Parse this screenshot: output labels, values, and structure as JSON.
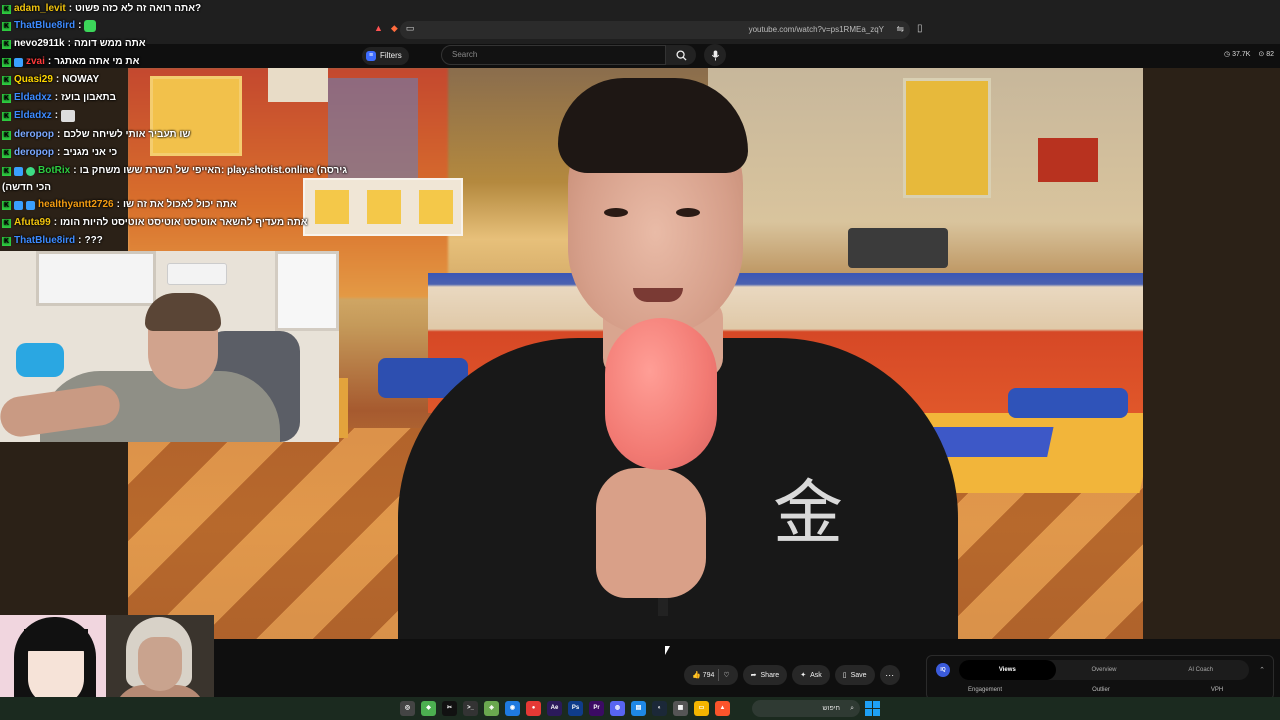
{
  "browser": {
    "url": "youtube.com/watch?v=ps1RMEa_zqY"
  },
  "youtube": {
    "filters_label": "Filters",
    "search_placeholder": "Search",
    "stats": {
      "views_stat": "37.7K",
      "score_stat": "82"
    }
  },
  "chat": {
    "messages": [
      {
        "user": "adam_levit",
        "user_color": "#f1c40f",
        "badges": [
          "k"
        ],
        "text": "אתה רואה זה לא כזה פשוט?"
      },
      {
        "user": "ThatBlue8ird",
        "user_color": "#3d8bff",
        "badges": [
          "k"
        ],
        "text": "",
        "emote": "green"
      },
      {
        "user": "nevo2911k",
        "user_color": "#ffffff",
        "badges": [
          "k"
        ],
        "text": "אתה ממש דומה"
      },
      {
        "user": "zvai",
        "user_color": "#ff3b3b",
        "badges": [
          "k",
          "b"
        ],
        "text": "את מי אתה מאתגר"
      },
      {
        "user": "Quasi29",
        "user_color": "#ffd700",
        "badges": [
          "k"
        ],
        "text": "NOWAY"
      },
      {
        "user": "Eldadxz",
        "user_color": "#3d8bff",
        "badges": [
          "k"
        ],
        "text": "בתאבון בועז"
      },
      {
        "user": "Eldadxz",
        "user_color": "#3d8bff",
        "badges": [
          "k"
        ],
        "text": "",
        "emote": "card"
      },
      {
        "user": "deropop",
        "user_color": "#7aa8ff",
        "badges": [
          "k"
        ],
        "text": "שו תעביר אותי לשיחה שלכם"
      },
      {
        "user": "deropop",
        "user_color": "#7aa8ff",
        "badges": [
          "k"
        ],
        "text": "כי אני מגניב"
      },
      {
        "user": "BotRix",
        "user_color": "#2ecc40",
        "badges": [
          "k",
          "b",
          "g"
        ],
        "text": "האייפי של השרת ששו משחק בו: play.shotist.online (גירסה"
      },
      {
        "user": "",
        "user_color": "#ffffff",
        "badges": [],
        "text": "(הכי חדשה"
      },
      {
        "user": "healthyantt2726",
        "user_color": "#f39c12",
        "badges": [
          "k",
          "b",
          "b"
        ],
        "text": "אתה יכול לאכול את זה שו"
      },
      {
        "user": "Afuta99",
        "user_color": "#f1c40f",
        "badges": [
          "k"
        ],
        "text": "אתה מעדיף להשאר אוטיסט אוטיסט אוטיסט להיות הומו"
      },
      {
        "user": "ThatBlue8ird",
        "user_color": "#3d8bff",
        "badges": [
          "k"
        ],
        "text": "???"
      }
    ]
  },
  "video": {
    "shirt_glyph": "金"
  },
  "actions": {
    "like_count": "794",
    "share_label": "Share",
    "ask_label": "Ask",
    "save_label": "Save"
  },
  "ai_panel": {
    "logo": "IQ",
    "tabs": [
      "Views",
      "Overview",
      "AI Coach"
    ],
    "active_tab": "Views",
    "metrics": [
      "Engagement",
      "Outlier",
      "VPH"
    ]
  },
  "taskbar": {
    "search_text": "חיפוש",
    "apps": [
      "copilot-icon",
      "minecraft-icon",
      "capcut-icon",
      "terminal-icon",
      "cube-icon",
      "edge-icon",
      "chrome-icon",
      "after-effects-icon",
      "photoshop-icon",
      "premiere-icon",
      "discord-icon",
      "notepad-icon",
      "steam-icon",
      "store-icon",
      "files-icon",
      "brave-icon"
    ]
  }
}
